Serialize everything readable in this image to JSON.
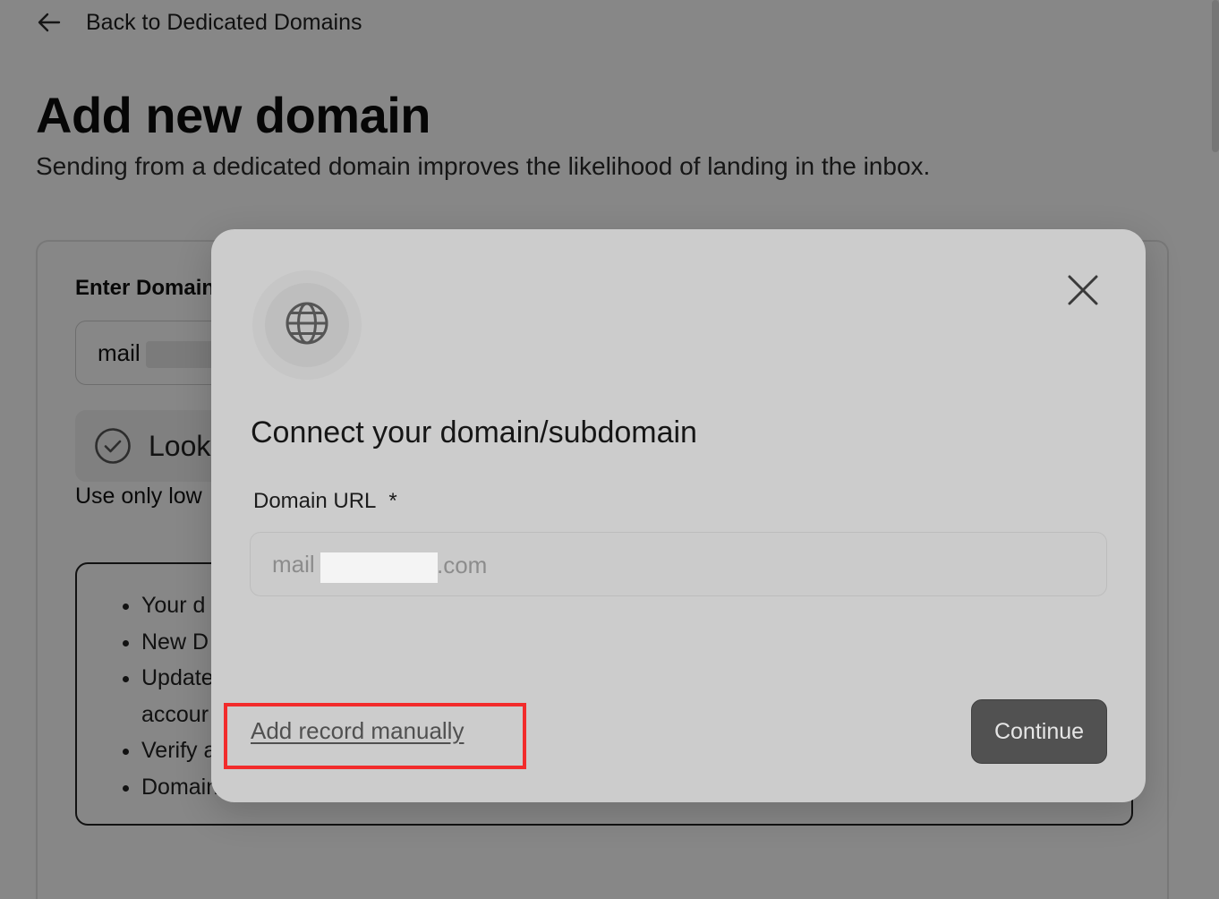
{
  "back_nav": {
    "label": "Back to Dedicated Domains",
    "icon": "arrow-left-icon"
  },
  "page": {
    "title": "Add new domain",
    "subtitle": "Sending from a dedicated domain improves the likelihood of landing in the inbox."
  },
  "background_form": {
    "label": "Enter Domain",
    "input_value": "mail",
    "status_text": "Looks",
    "status_icon": "check-circle-icon",
    "hint": "Use only low",
    "info_items": [
      "Your d",
      "New D",
      "Update",
      "accour",
      "Verify a",
      "Domain"
    ]
  },
  "modal": {
    "icon": "globe-icon",
    "close_icon": "close-icon",
    "title": "Connect your domain/subdomain",
    "field_label": "Domain URL",
    "required_mark": "*",
    "input_placeholder_prefix": "mail",
    "input_placeholder_suffix": ".com",
    "manual_link": "Add record manually",
    "continue_button": "Continue"
  },
  "colors": {
    "overlay": "rgba(0,0,0,0.47)",
    "modal_bg": "#cccccc",
    "continue_bg": "#515151",
    "highlight": "#f22b2b"
  }
}
